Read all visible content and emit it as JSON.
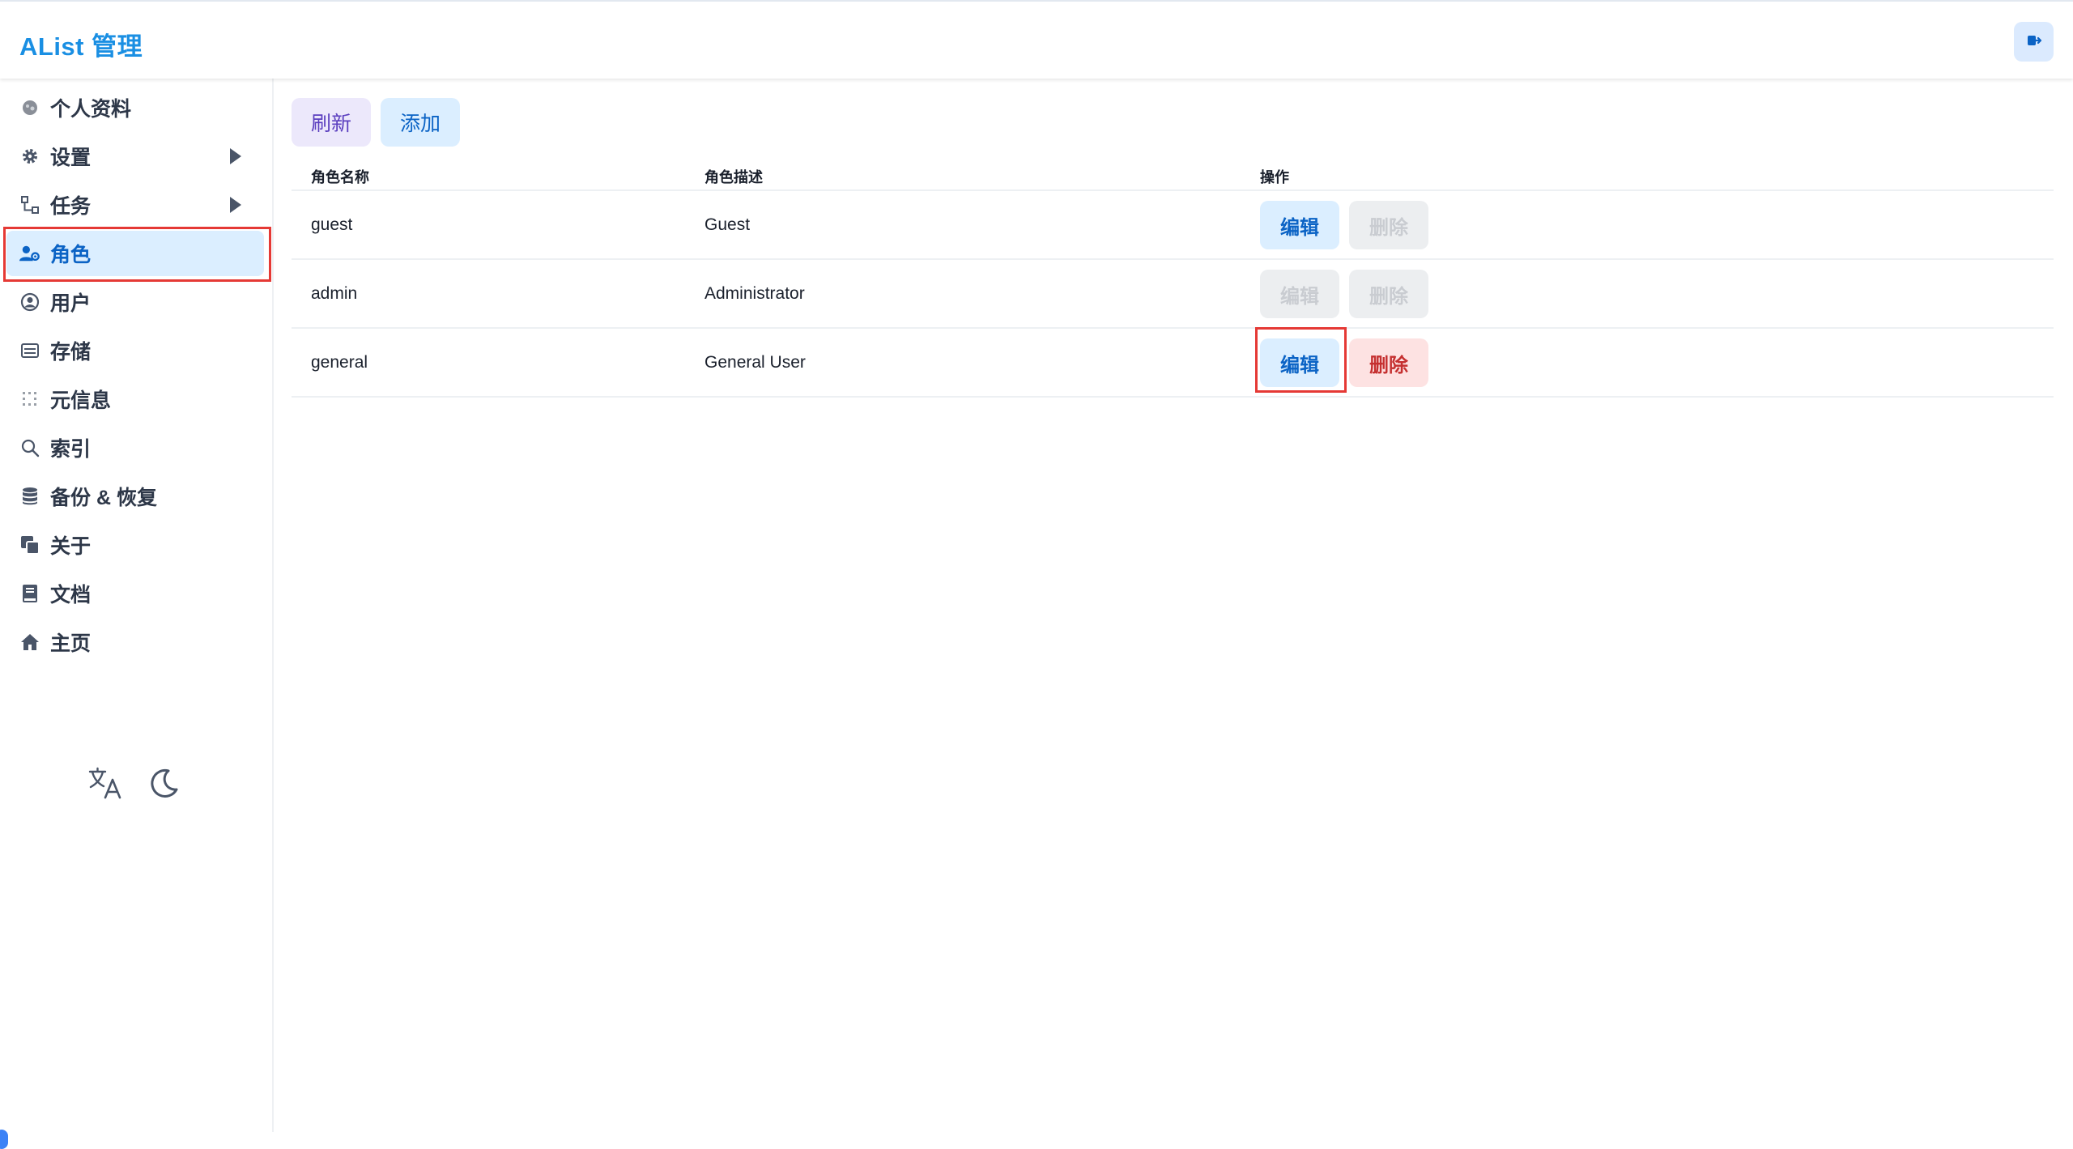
{
  "header": {
    "title": "AList 管理",
    "logout_icon": "logout-icon"
  },
  "sidebar": {
    "items": [
      {
        "label": "个人资料",
        "icon": "profile-icon"
      },
      {
        "label": "设置",
        "icon": "gear-icon",
        "has_submenu": true
      },
      {
        "label": "任务",
        "icon": "tasks-icon",
        "has_submenu": true
      },
      {
        "label": "角色",
        "icon": "role-icon",
        "active": true
      },
      {
        "label": "用户",
        "icon": "user-icon"
      },
      {
        "label": "存储",
        "icon": "storage-icon"
      },
      {
        "label": "元信息",
        "icon": "meta-icon"
      },
      {
        "label": "索引",
        "icon": "search-icon"
      },
      {
        "label": "备份 & 恢复",
        "icon": "database-icon"
      },
      {
        "label": "关于",
        "icon": "about-icon"
      },
      {
        "label": "文档",
        "icon": "book-icon"
      },
      {
        "label": "主页",
        "icon": "home-icon"
      }
    ],
    "bottom": {
      "language_icon": "translate-icon",
      "theme_icon": "moon-icon"
    }
  },
  "toolbar": {
    "refresh_label": "刷新",
    "add_label": "添加"
  },
  "table": {
    "columns": [
      "角色名称",
      "角色描述",
      "操作"
    ],
    "rows": [
      {
        "name": "guest",
        "description": "Guest",
        "edit_label": "编辑",
        "delete_label": "删除",
        "edit_enabled": true,
        "delete_enabled": false
      },
      {
        "name": "admin",
        "description": "Administrator",
        "edit_label": "编辑",
        "delete_label": "删除",
        "edit_enabled": false,
        "delete_enabled": false
      },
      {
        "name": "general",
        "description": "General User",
        "edit_label": "编辑",
        "delete_label": "删除",
        "edit_enabled": true,
        "delete_enabled": true
      }
    ]
  },
  "colors": {
    "brand": "#1a8fe3",
    "active_bg": "#dbeeff",
    "active_text": "#0b63c5",
    "danger_bg": "#fde2e2",
    "danger_text": "#c53030",
    "highlight": "#e53935"
  }
}
